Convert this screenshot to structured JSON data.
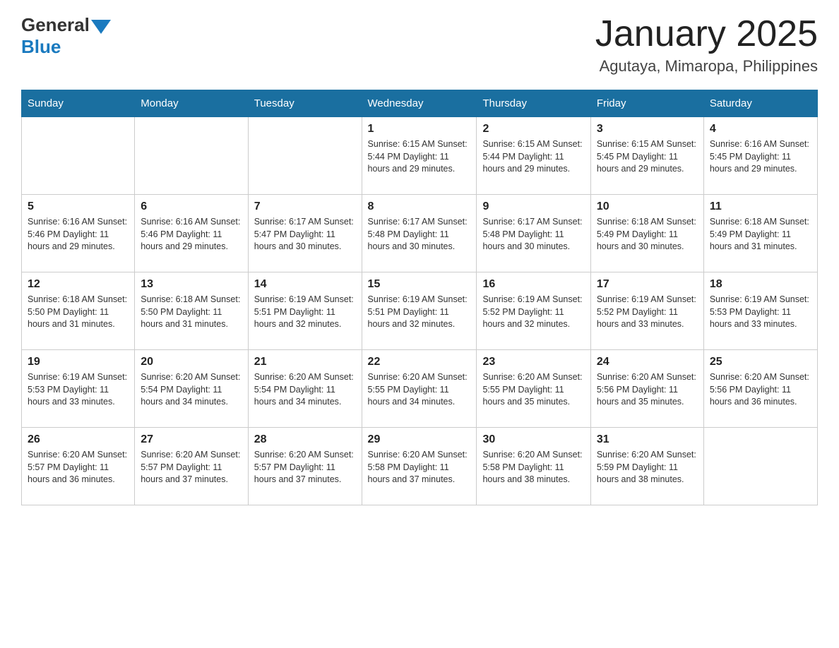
{
  "header": {
    "logo": {
      "general": "General",
      "blue": "Blue"
    },
    "title": "January 2025",
    "location": "Agutaya, Mimaropa, Philippines"
  },
  "weekdays": [
    "Sunday",
    "Monday",
    "Tuesday",
    "Wednesday",
    "Thursday",
    "Friday",
    "Saturday"
  ],
  "weeks": [
    [
      {
        "day": "",
        "info": ""
      },
      {
        "day": "",
        "info": ""
      },
      {
        "day": "",
        "info": ""
      },
      {
        "day": "1",
        "info": "Sunrise: 6:15 AM\nSunset: 5:44 PM\nDaylight: 11 hours and 29 minutes."
      },
      {
        "day": "2",
        "info": "Sunrise: 6:15 AM\nSunset: 5:44 PM\nDaylight: 11 hours and 29 minutes."
      },
      {
        "day": "3",
        "info": "Sunrise: 6:15 AM\nSunset: 5:45 PM\nDaylight: 11 hours and 29 minutes."
      },
      {
        "day": "4",
        "info": "Sunrise: 6:16 AM\nSunset: 5:45 PM\nDaylight: 11 hours and 29 minutes."
      }
    ],
    [
      {
        "day": "5",
        "info": "Sunrise: 6:16 AM\nSunset: 5:46 PM\nDaylight: 11 hours and 29 minutes."
      },
      {
        "day": "6",
        "info": "Sunrise: 6:16 AM\nSunset: 5:46 PM\nDaylight: 11 hours and 29 minutes."
      },
      {
        "day": "7",
        "info": "Sunrise: 6:17 AM\nSunset: 5:47 PM\nDaylight: 11 hours and 30 minutes."
      },
      {
        "day": "8",
        "info": "Sunrise: 6:17 AM\nSunset: 5:48 PM\nDaylight: 11 hours and 30 minutes."
      },
      {
        "day": "9",
        "info": "Sunrise: 6:17 AM\nSunset: 5:48 PM\nDaylight: 11 hours and 30 minutes."
      },
      {
        "day": "10",
        "info": "Sunrise: 6:18 AM\nSunset: 5:49 PM\nDaylight: 11 hours and 30 minutes."
      },
      {
        "day": "11",
        "info": "Sunrise: 6:18 AM\nSunset: 5:49 PM\nDaylight: 11 hours and 31 minutes."
      }
    ],
    [
      {
        "day": "12",
        "info": "Sunrise: 6:18 AM\nSunset: 5:50 PM\nDaylight: 11 hours and 31 minutes."
      },
      {
        "day": "13",
        "info": "Sunrise: 6:18 AM\nSunset: 5:50 PM\nDaylight: 11 hours and 31 minutes."
      },
      {
        "day": "14",
        "info": "Sunrise: 6:19 AM\nSunset: 5:51 PM\nDaylight: 11 hours and 32 minutes."
      },
      {
        "day": "15",
        "info": "Sunrise: 6:19 AM\nSunset: 5:51 PM\nDaylight: 11 hours and 32 minutes."
      },
      {
        "day": "16",
        "info": "Sunrise: 6:19 AM\nSunset: 5:52 PM\nDaylight: 11 hours and 32 minutes."
      },
      {
        "day": "17",
        "info": "Sunrise: 6:19 AM\nSunset: 5:52 PM\nDaylight: 11 hours and 33 minutes."
      },
      {
        "day": "18",
        "info": "Sunrise: 6:19 AM\nSunset: 5:53 PM\nDaylight: 11 hours and 33 minutes."
      }
    ],
    [
      {
        "day": "19",
        "info": "Sunrise: 6:19 AM\nSunset: 5:53 PM\nDaylight: 11 hours and 33 minutes."
      },
      {
        "day": "20",
        "info": "Sunrise: 6:20 AM\nSunset: 5:54 PM\nDaylight: 11 hours and 34 minutes."
      },
      {
        "day": "21",
        "info": "Sunrise: 6:20 AM\nSunset: 5:54 PM\nDaylight: 11 hours and 34 minutes."
      },
      {
        "day": "22",
        "info": "Sunrise: 6:20 AM\nSunset: 5:55 PM\nDaylight: 11 hours and 34 minutes."
      },
      {
        "day": "23",
        "info": "Sunrise: 6:20 AM\nSunset: 5:55 PM\nDaylight: 11 hours and 35 minutes."
      },
      {
        "day": "24",
        "info": "Sunrise: 6:20 AM\nSunset: 5:56 PM\nDaylight: 11 hours and 35 minutes."
      },
      {
        "day": "25",
        "info": "Sunrise: 6:20 AM\nSunset: 5:56 PM\nDaylight: 11 hours and 36 minutes."
      }
    ],
    [
      {
        "day": "26",
        "info": "Sunrise: 6:20 AM\nSunset: 5:57 PM\nDaylight: 11 hours and 36 minutes."
      },
      {
        "day": "27",
        "info": "Sunrise: 6:20 AM\nSunset: 5:57 PM\nDaylight: 11 hours and 37 minutes."
      },
      {
        "day": "28",
        "info": "Sunrise: 6:20 AM\nSunset: 5:57 PM\nDaylight: 11 hours and 37 minutes."
      },
      {
        "day": "29",
        "info": "Sunrise: 6:20 AM\nSunset: 5:58 PM\nDaylight: 11 hours and 37 minutes."
      },
      {
        "day": "30",
        "info": "Sunrise: 6:20 AM\nSunset: 5:58 PM\nDaylight: 11 hours and 38 minutes."
      },
      {
        "day": "31",
        "info": "Sunrise: 6:20 AM\nSunset: 5:59 PM\nDaylight: 11 hours and 38 minutes."
      },
      {
        "day": "",
        "info": ""
      }
    ]
  ]
}
